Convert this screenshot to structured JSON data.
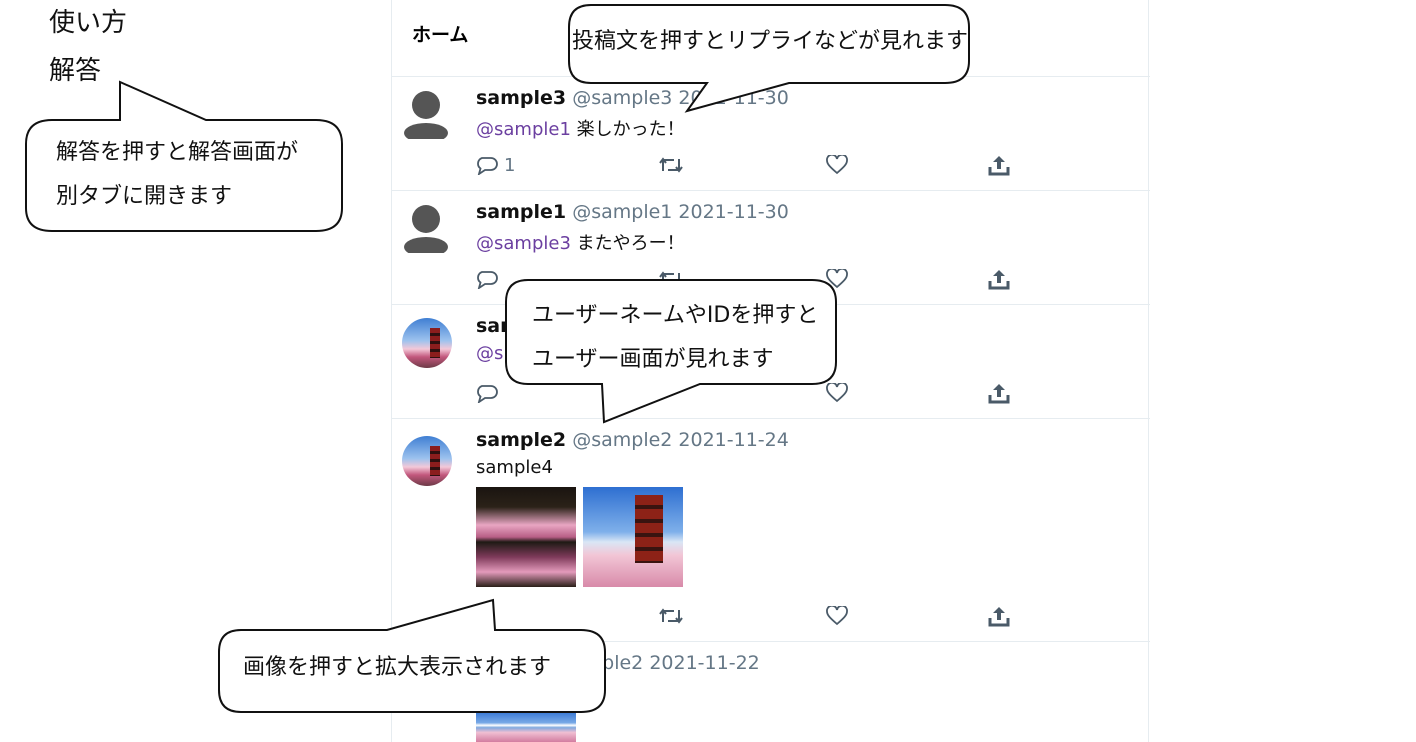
{
  "sidebar": {
    "usage_link": "使い方",
    "answer_link": "解答"
  },
  "timeline": {
    "title": "ホーム",
    "tweets": [
      {
        "name": "sample3",
        "handle": "@sample3",
        "date": "2021-11-30",
        "mention": "@sample1",
        "text": " 楽しかった！",
        "reply_count": "1",
        "avatar": "default-avatar"
      },
      {
        "name": "sample1",
        "handle": "@sample1",
        "date": "2021-11-30",
        "mention": "@sample3",
        "text": " またやろー！",
        "reply_count": "",
        "avatar": "default-avatar"
      },
      {
        "name": "sam",
        "handle": "",
        "date": "",
        "mention": "@s",
        "text": "",
        "reply_count": "",
        "avatar": "pagoda-photo"
      },
      {
        "name": "sample2",
        "handle": "@sample2",
        "date": "2021-11-24",
        "text": "sample4",
        "reply_count": "",
        "avatar": "pagoda-photo",
        "images": [
          "cherry-blossom-reflection",
          "pagoda-mount-fuji"
        ]
      },
      {
        "name": "",
        "handle": "ample2",
        "date": "2021-11-22",
        "text": "",
        "avatar": "pagoda-photo",
        "images": [
          "mount-fuji-blossoms"
        ]
      }
    ]
  },
  "callouts": {
    "answer": {
      "line1": "解答を押すと解答画面が",
      "line2": "別タブに開きます"
    },
    "post": {
      "line1": "投稿文を押すとリプライなどが見れます"
    },
    "username": {
      "line1": "ユーザーネームやIDを押すと",
      "line2": "ユーザー画面が見れます"
    },
    "image": {
      "line1": "画像を押すと拡大表示されます"
    }
  },
  "colors": {
    "mention": "#6b3fa0",
    "meta": "#657786",
    "divider": "#e6ecf0"
  },
  "icons": [
    "reply-icon",
    "retweet-icon",
    "like-icon",
    "share-icon",
    "default-avatar-icon"
  ]
}
